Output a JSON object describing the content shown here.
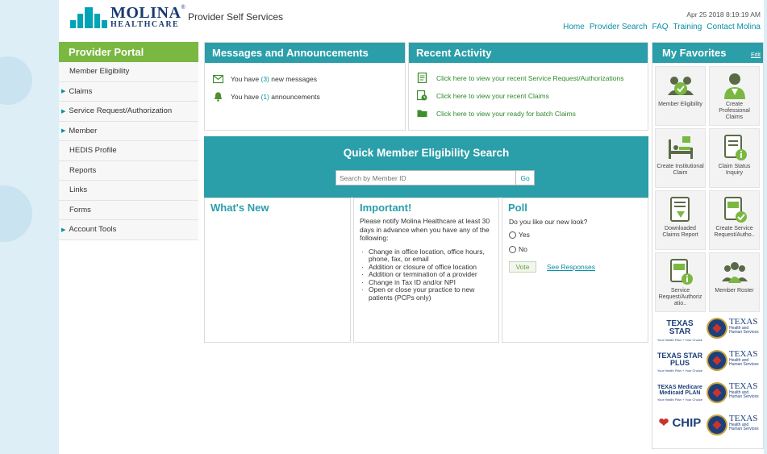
{
  "header": {
    "logo_name": "MOLINA",
    "logo_mark": "®",
    "logo_sub": "HEALTHCARE",
    "app_title": "Provider Self Services",
    "timestamp": "Apr 25 2018 8:19:19 AM",
    "nav": [
      "Home",
      "Provider Search",
      "FAQ",
      "Training",
      "Contact Molina"
    ]
  },
  "sidebar": {
    "title": "Provider Portal",
    "items": [
      {
        "label": "Member Eligibility",
        "arrow": false
      },
      {
        "label": "Claims",
        "arrow": true
      },
      {
        "label": "Service Request/Authorization",
        "arrow": true
      },
      {
        "label": "Member",
        "arrow": true
      },
      {
        "label": "HEDIS Profile",
        "arrow": false
      },
      {
        "label": "Reports",
        "arrow": false
      },
      {
        "label": "Links",
        "arrow": false
      },
      {
        "label": "Forms",
        "arrow": false
      },
      {
        "label": "Account Tools",
        "arrow": true
      }
    ]
  },
  "messages": {
    "title": "Messages and Announcements",
    "new_messages": {
      "pre": "You have ",
      "count": "(3)",
      "post": " new messages"
    },
    "announcements": {
      "pre": "You have ",
      "count": "(1)",
      "post": " announcements"
    }
  },
  "recent_activity": {
    "title": "Recent Activity",
    "items": [
      "Click here to view your recent Service Request/Authorizations",
      "Click here to view your recent Claims",
      "Click here to view your ready for batch Claims"
    ]
  },
  "quick_search": {
    "title": "Quick Member Eligibility Search",
    "placeholder": "Search by Member ID",
    "go_label": "Go"
  },
  "whats_new": {
    "title": "What's New"
  },
  "important": {
    "title": "Important!",
    "intro": "Please notify Molina Healthcare at least 30 days in advance when you have any of the following:",
    "items": [
      "Change in office location, office hours, phone, fax, or email",
      "Addition or closure of office location",
      "Addition or termination of a provider",
      "Change in Tax ID and/or NPI",
      "Open or close your practice to new patients (PCPs only)"
    ]
  },
  "poll": {
    "title": "Poll",
    "question": "Do you like our new look?",
    "options": [
      "Yes",
      "No"
    ],
    "vote_label": "Vote",
    "responses_label": "See Responses"
  },
  "favorites": {
    "title": "My Favorites",
    "edit_label": "Edit",
    "tiles": [
      {
        "label": "Member Eligibility",
        "icon": "member-eligibility-icon"
      },
      {
        "label": "Create Professional Claims",
        "icon": "doctor-icon"
      },
      {
        "label": "Create Institutional Claim",
        "icon": "hospital-bed-icon"
      },
      {
        "label": "Claim Status Inquiry",
        "icon": "document-info-icon"
      },
      {
        "label": "Downloaded Claims Report",
        "icon": "download-document-icon"
      },
      {
        "label": "Create Service Request/Autho..",
        "icon": "sra-check-icon"
      },
      {
        "label": "Service Request/Authoriz atio..",
        "icon": "sra-info-icon"
      },
      {
        "label": "Member Roster",
        "icon": "member-roster-icon"
      }
    ],
    "partner_logos": [
      {
        "label": "TEXAS STAR",
        "tagline": "Your Health Plan + Your Choice"
      },
      {
        "label": "TEXAS STAR PLUS",
        "tagline": "Your Health Plan + Your Choice"
      },
      {
        "label": "TEXAS Medicare Medicaid PLAN",
        "tagline": "Your Health Plan + Your Choice"
      },
      {
        "label": "CHIP",
        "tagline": ""
      }
    ],
    "seal_title": "TEXAS",
    "seal_sub": "Health and Human Services"
  },
  "colors": {
    "teal": "#2a9ea9",
    "green": "#7ab841",
    "navy": "#1a3a6e",
    "link": "#0a8fa7"
  }
}
